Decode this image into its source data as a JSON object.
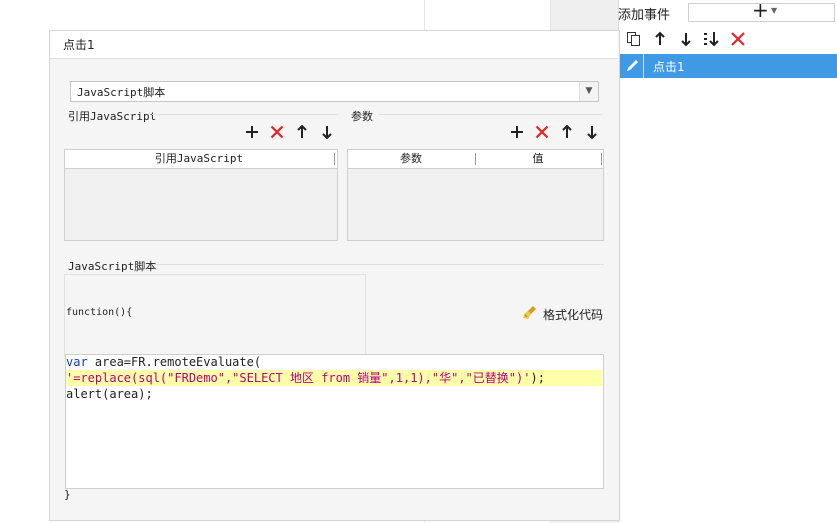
{
  "right_panel": {
    "add_event_label": "添加事件",
    "add_event_button": "+",
    "toolbar_icons": [
      "copy-icon",
      "arrow-up-icon",
      "arrow-down-icon",
      "move-bottom-icon",
      "delete-icon"
    ],
    "events": [
      {
        "label": "点击1",
        "icon": "pencil-icon",
        "selected": true
      }
    ]
  },
  "dialog": {
    "title": "点击1",
    "type_select": {
      "value": "JavaScript脚本"
    },
    "ref_js": {
      "section_label": "引用JavaScript",
      "columns": [
        "引用JavaScript"
      ],
      "rows": []
    },
    "params": {
      "section_label": "参数",
      "columns": [
        "参数",
        "值"
      ],
      "rows": []
    },
    "script": {
      "section_label": "JavaScript脚本",
      "function_head": "function(){",
      "format_label": "格式化代码",
      "code": {
        "line1_kw": "var",
        "line1_rest": " area=FR.remoteEvaluate(",
        "line2": "'=replace(sql(\"FRDemo\",\"SELECT 地区 from 销量\",1,1),\"华\",\"已替换\")'",
        "line2_end": ");",
        "line3": "alert(area);"
      },
      "function_close": "}"
    },
    "colors": {
      "selection": "#3f9ae6",
      "delete": "#e02626",
      "highlight_line": "#ffffaa",
      "keyword": "#0b3eb8",
      "string": "#b40083"
    }
  }
}
